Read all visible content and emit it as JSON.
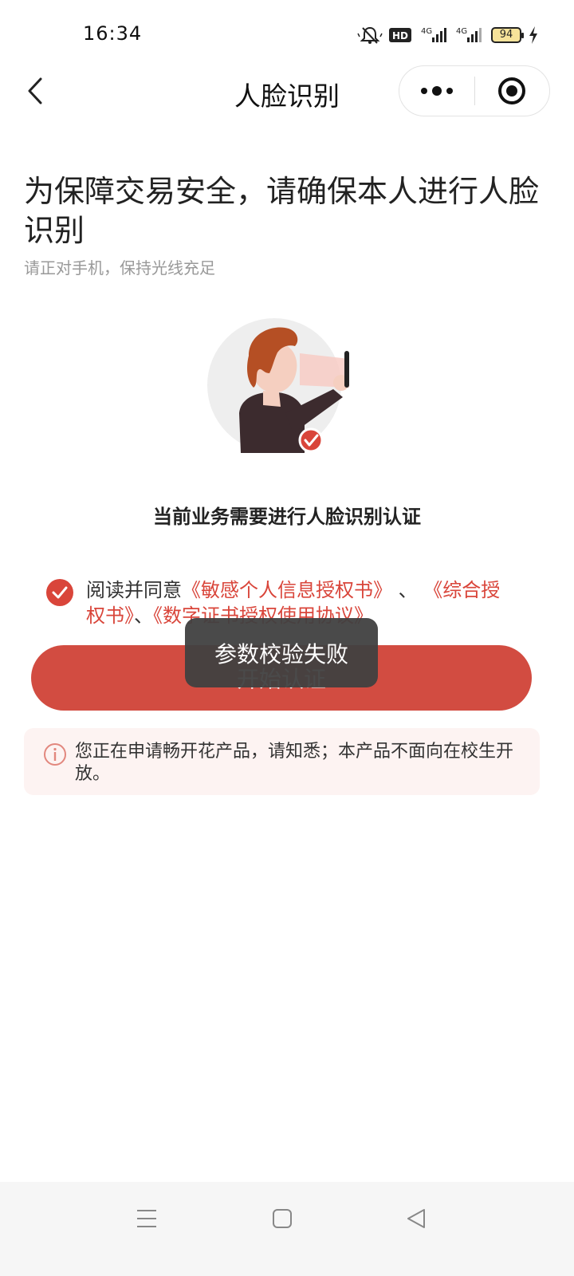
{
  "status_bar": {
    "time": "16:34",
    "hd_label": "HD",
    "network_1": "4G",
    "network_2": "4G",
    "battery": "94"
  },
  "nav": {
    "title": "人脸识别",
    "icons": [
      "back-arrow-icon",
      "more-dots-icon",
      "target-icon"
    ]
  },
  "page": {
    "headline": "为保障交易安全，请确保本人进行人脸识别",
    "subhead": "请正对手机，保持光线充足",
    "verify_label": "当前业务需要进行人脸识别认证"
  },
  "agreement": {
    "prefix": "阅读并同意",
    "doc_1": "《敏感个人信息授权书》",
    "separator_1": "、",
    "doc_2": "《综合授权书》",
    "separator_2": "、",
    "doc_3": "《数字证书授权使用协议》",
    "checked": true
  },
  "primary_button": {
    "label": "开始认证"
  },
  "notice": {
    "text": "您正在申请畅开花产品，请知悉；本产品不面向在校生开放。"
  },
  "toast": {
    "text": "参数校验失败"
  },
  "colors": {
    "accent": "#d24c41",
    "link": "#d9453a",
    "notice_bg": "#fdf3f2",
    "toast_bg": "#404040"
  },
  "system_nav": {
    "icons": [
      "menu-icon",
      "home-icon",
      "back-triangle-icon"
    ]
  }
}
